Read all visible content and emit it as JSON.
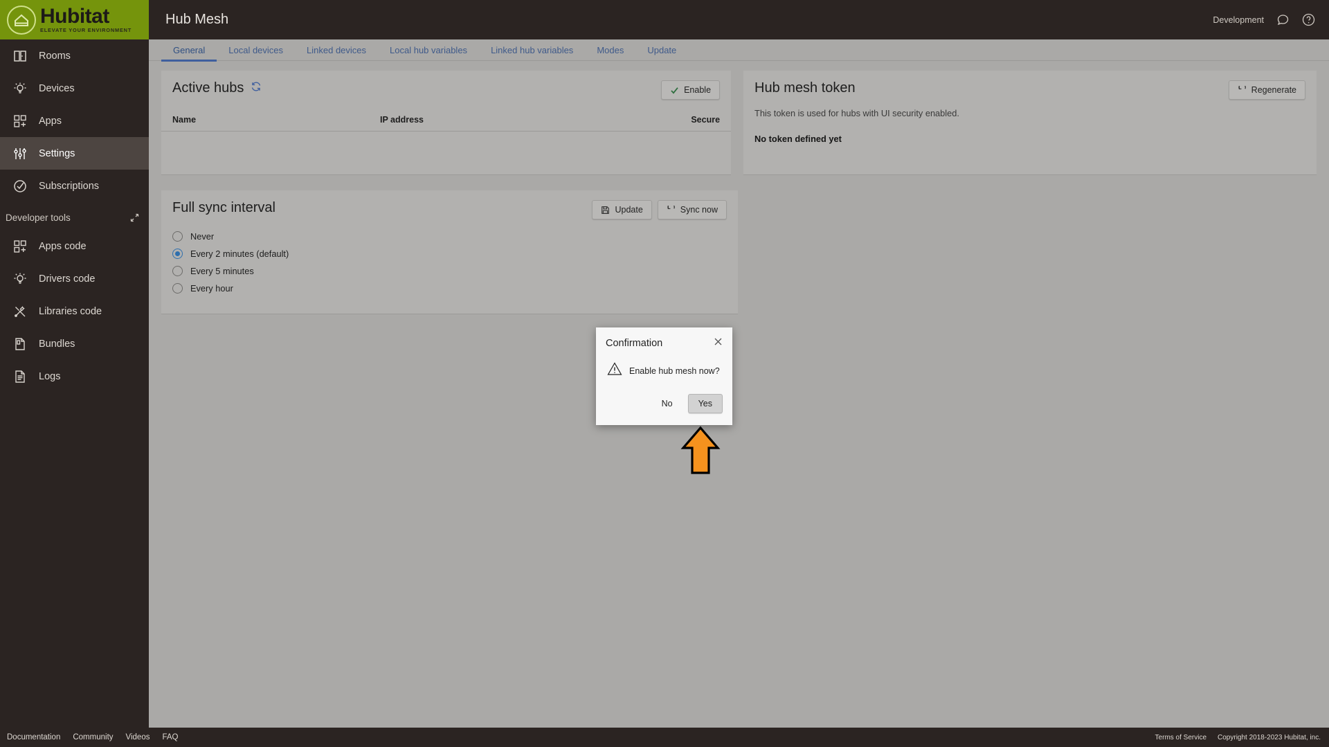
{
  "brand": {
    "name": "Hubitat",
    "tagline": "ELEVATE YOUR ENVIRONMENT",
    "green": "#75940c"
  },
  "topbar": {
    "title": "Hub Mesh",
    "environment": "Development",
    "chat_icon": "chat-bubble-icon",
    "help_icon": "help-circle-icon"
  },
  "sidebar": {
    "items": [
      {
        "label": "Rooms",
        "icon": "rooms-icon",
        "active": false
      },
      {
        "label": "Devices",
        "icon": "devices-bulb-icon",
        "active": false
      },
      {
        "label": "Apps",
        "icon": "apps-grid-icon",
        "active": false
      },
      {
        "label": "Settings",
        "icon": "settings-sliders-icon",
        "active": true
      },
      {
        "label": "Subscriptions",
        "icon": "check-circle-icon",
        "active": false
      }
    ],
    "section_label": "Developer tools",
    "collapse_icon": "collapse-arrows-icon",
    "dev_items": [
      {
        "label": "Apps code",
        "icon": "apps-grid-icon"
      },
      {
        "label": "Drivers code",
        "icon": "devices-bulb-icon"
      },
      {
        "label": "Libraries code",
        "icon": "tools-icon"
      },
      {
        "label": "Bundles",
        "icon": "bundle-file-icon"
      },
      {
        "label": "Logs",
        "icon": "logs-document-icon"
      }
    ]
  },
  "tabs": [
    {
      "label": "General",
      "active": true
    },
    {
      "label": "Local devices",
      "active": false
    },
    {
      "label": "Linked devices",
      "active": false
    },
    {
      "label": "Local hub variables",
      "active": false
    },
    {
      "label": "Linked hub variables",
      "active": false
    },
    {
      "label": "Modes",
      "active": false
    },
    {
      "label": "Update",
      "active": false
    }
  ],
  "active_hubs": {
    "title": "Active hubs",
    "refresh_icon": "refresh-icon",
    "enable_button": "Enable",
    "enable_icon": "check-icon",
    "columns": [
      "Name",
      "IP address",
      "Secure"
    ],
    "rows": []
  },
  "hub_mesh_token": {
    "title": "Hub mesh token",
    "regenerate_button": "Regenerate",
    "regenerate_icon": "refresh-icon",
    "description": "This token is used for hubs with UI security enabled.",
    "status": "No token defined yet"
  },
  "full_sync": {
    "title": "Full sync interval",
    "update_button": "Update",
    "update_icon": "save-disk-icon",
    "sync_button": "Sync now",
    "sync_icon": "refresh-icon",
    "options": [
      {
        "label": "Never",
        "selected": false
      },
      {
        "label": "Every 2 minutes (default)",
        "selected": true
      },
      {
        "label": "Every 5 minutes",
        "selected": false
      },
      {
        "label": "Every hour",
        "selected": false
      }
    ]
  },
  "modal": {
    "title": "Confirmation",
    "close_icon": "close-icon",
    "warning_icon": "warning-triangle-icon",
    "message": "Enable hub mesh now?",
    "no_label": "No",
    "yes_label": "Yes",
    "highlight_arrow": "up-arrow-annotation",
    "arrow_color": "#f5921e"
  },
  "footer": {
    "links": [
      "Documentation",
      "Community",
      "Videos",
      "FAQ"
    ],
    "terms": "Terms of Service",
    "copyright": "Copyright 2018-2023 Hubitat, inc."
  }
}
